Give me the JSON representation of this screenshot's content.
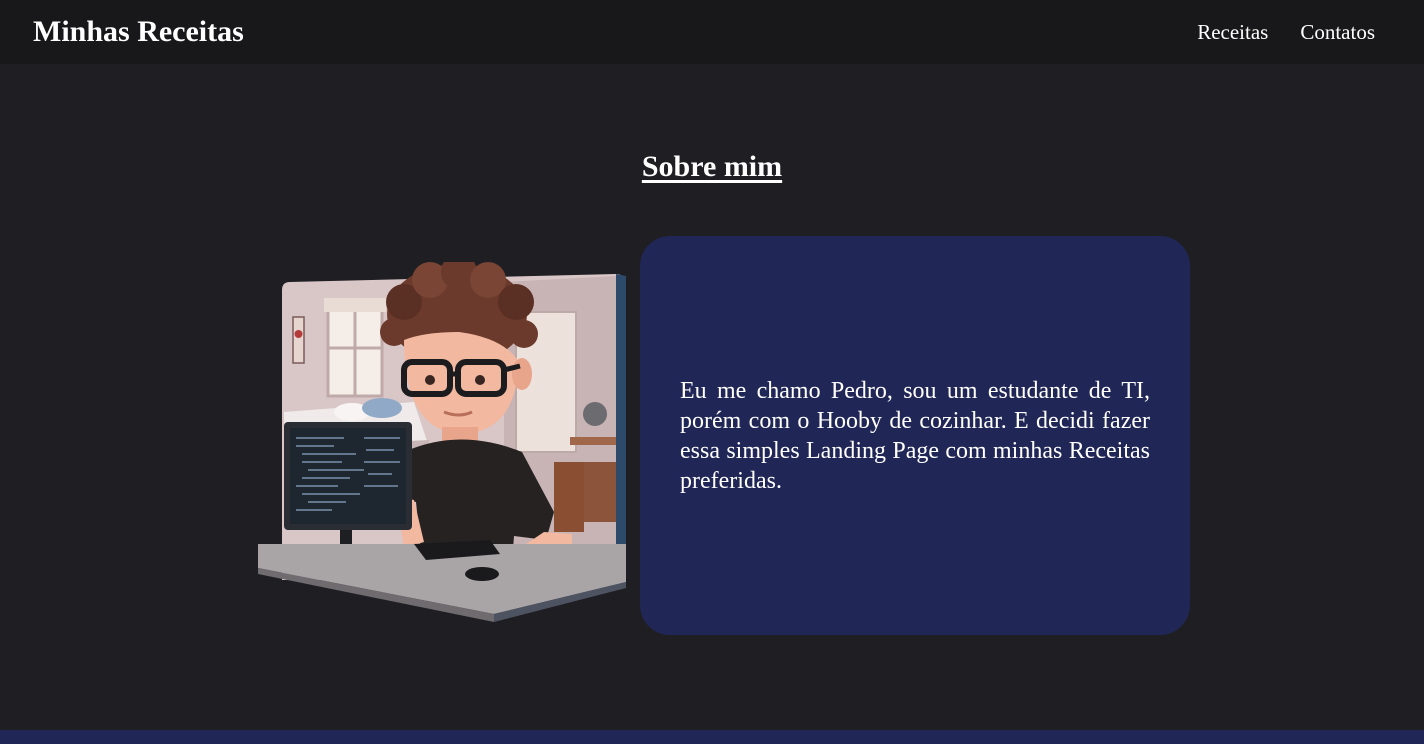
{
  "header": {
    "brand": "Minhas Receitas",
    "nav": [
      {
        "label": "Receitas"
      },
      {
        "label": "Contatos"
      }
    ]
  },
  "about": {
    "title": "Sobre mim",
    "text": "Eu me chamo Pedro, sou um estudante de TI, porém com o Hooby de cozinhar. E decidi fazer essa simples Landing Page com minhas Receitas preferidas.",
    "image_icon": "developer-avatar-illustration"
  },
  "colors": {
    "page_bg": "#1f1f23",
    "header_bg": "#18181a",
    "card_bg": "#202656",
    "text": "#ffffff"
  }
}
